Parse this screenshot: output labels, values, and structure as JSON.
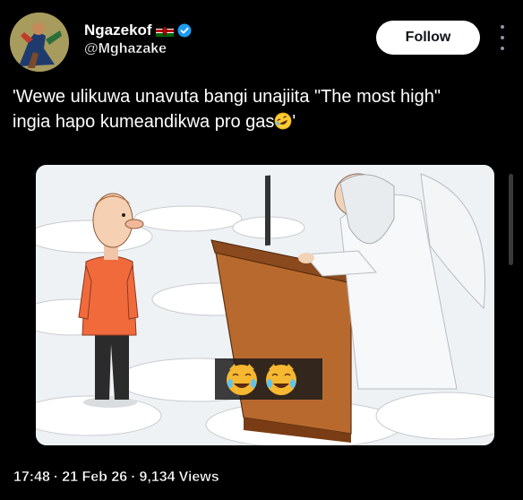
{
  "user": {
    "display_name": "Ngazekof",
    "handle": "@Mghazake",
    "flag_icon": "kenya-flag-icon",
    "verified_icon": "verified-badge-icon",
    "verified_color": "#1d9bf0"
  },
  "follow_button": {
    "label": "Follow"
  },
  "tweet": {
    "text_line1": "'Wewe ulikuwa unavuta bangi unajiita \"The most high\"",
    "text_line2": "ingia hapo kumeandikwa pro gas",
    "text_end": "'",
    "emoji_icon": "rolling-on-floor-laughing-icon"
  },
  "media": {
    "description_icons": [
      "crying-laughing-cat-icon",
      "crying-laughing-cat-icon"
    ]
  },
  "meta": {
    "time": "17:48",
    "date": "21 Feb 26",
    "views": "9,134",
    "views_label": "Views",
    "separator": "·"
  },
  "colors": {
    "background": "#000000",
    "text": "#ffffff",
    "follow_bg": "#ffffff",
    "follow_text": "#0f1419"
  }
}
